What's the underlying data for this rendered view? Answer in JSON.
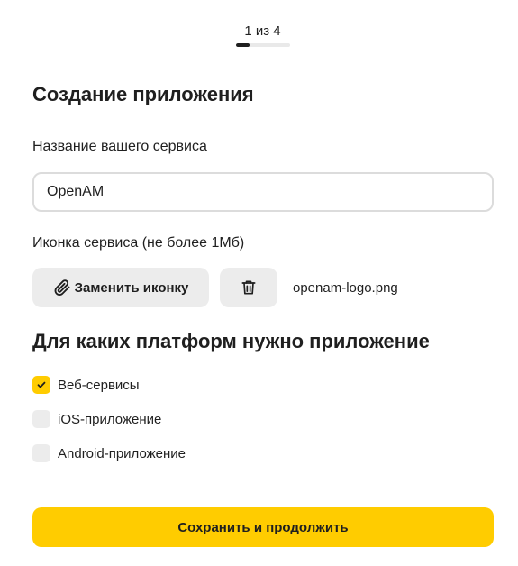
{
  "stepper": {
    "label": "1 из 4",
    "progress": 0.25
  },
  "title": "Создание приложения",
  "service_name": {
    "label": "Название вашего сервиса",
    "value": "OpenAM"
  },
  "service_icon": {
    "label": "Иконка сервиса (не более 1Мб)",
    "replace_label": "Заменить иконку",
    "replace_icon": "paperclip-icon",
    "delete_icon": "trash-icon",
    "file_name": "openam-logo.png"
  },
  "platforms": {
    "title": "Для каких платформ нужно приложение",
    "options": [
      {
        "label": "Веб-сервисы",
        "checked": true
      },
      {
        "label": "iOS-приложение",
        "checked": false
      },
      {
        "label": "Android-приложение",
        "checked": false
      }
    ]
  },
  "submit_label": "Сохранить и продолжить",
  "colors": {
    "accent": "#ffcc00",
    "button_gray": "#ececec",
    "progress_fill": "#1f1f1f",
    "progress_track": "#e9e9e9"
  }
}
